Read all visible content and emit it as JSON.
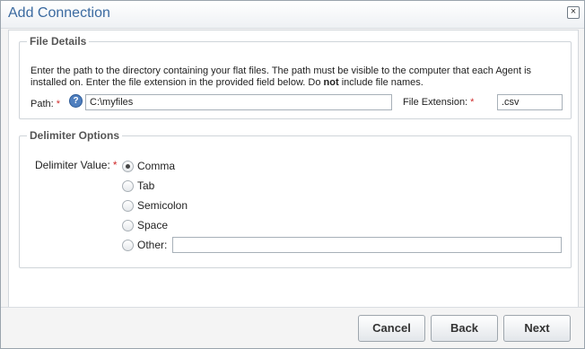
{
  "dialog": {
    "title": "Add Connection",
    "close_glyph": "×"
  },
  "file_details": {
    "legend": "File Details",
    "description_part1": "Enter the path to the directory containing your flat files. The path must be visible to the computer that each Agent is installed on. Enter the file extension in the provided field below. Do ",
    "description_bold": "not",
    "description_part2": " include file names.",
    "path_label": "Path:",
    "required_mark": "*",
    "help_glyph": "?",
    "path_value": "C:\\myfiles",
    "extension_label": "File Extension:",
    "extension_value": ".csv"
  },
  "delimiter_options": {
    "legend": "Delimiter Options",
    "label": "Delimiter Value:",
    "required_mark": "*",
    "options": [
      {
        "label": "Comma",
        "checked": true
      },
      {
        "label": "Tab",
        "checked": false
      },
      {
        "label": "Semicolon",
        "checked": false
      },
      {
        "label": "Space",
        "checked": false
      },
      {
        "label": "Other:",
        "checked": false
      }
    ],
    "other_value": ""
  },
  "footer": {
    "cancel_label": "Cancel",
    "back_label": "Back",
    "next_label": "Next"
  },
  "colors": {
    "title": "#3b6aa0",
    "required": "#d02c2c",
    "help_icon": "#4f7fbf"
  }
}
